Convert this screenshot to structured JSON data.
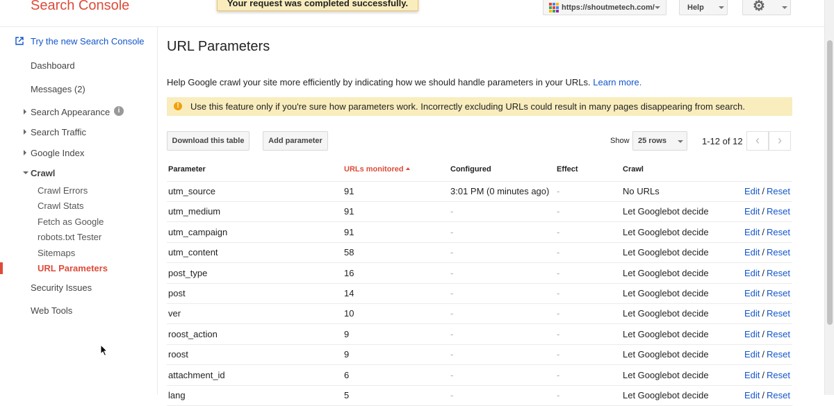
{
  "header": {
    "brand": "Search Console",
    "toast": "Your request was completed successfully.",
    "site": "https://shoutmetech.com/",
    "help_label": "Help",
    "settings_icon": "gear-icon"
  },
  "sidebar": {
    "new_console_link": "Try the new Search Console",
    "items": [
      {
        "label": "Dashboard"
      },
      {
        "label": "Messages (2)"
      },
      {
        "label": "Search Appearance"
      },
      {
        "label": "Search Traffic"
      },
      {
        "label": "Google Index"
      },
      {
        "label": "Crawl"
      },
      {
        "label": "Security Issues"
      },
      {
        "label": "Web Tools"
      }
    ],
    "crawl_children": [
      {
        "label": "Crawl Errors"
      },
      {
        "label": "Crawl Stats"
      },
      {
        "label": "Fetch as Google"
      },
      {
        "label": "robots.txt Tester"
      },
      {
        "label": "Sitemaps"
      },
      {
        "label": "URL Parameters"
      }
    ],
    "info_icon_glyph": "i",
    "active_color": "#dd4b39"
  },
  "main": {
    "title": "URL Parameters",
    "intro_text": "Help Google crawl your site more efficiently by indicating how we should handle parameters in your URLs.",
    "learn_more": "Learn more.",
    "warning": "Use this feature only if you're sure how parameters work. Incorrectly excluding URLs could result in many pages disappearing from search.",
    "warning_glyph": "!",
    "download_button": "Download this table",
    "add_parameter_button": "Add parameter",
    "show_label": "Show",
    "rows_option": "25 rows",
    "page_range": "1-12 of 12",
    "prev_glyph": "‹",
    "next_glyph": "›"
  },
  "table": {
    "headers": [
      "Parameter",
      "URLs monitored",
      "Configured",
      "Effect",
      "Crawl"
    ],
    "edit_label": "Edit",
    "separator": "/",
    "reset_label": "Reset",
    "rows": [
      {
        "parameter": "utm_source",
        "urls": "91",
        "configured": "3:01 PM (0 minutes ago)",
        "effect": "-",
        "crawl": "No URLs"
      },
      {
        "parameter": "utm_medium",
        "urls": "91",
        "configured": "-",
        "effect": "-",
        "crawl": "Let Googlebot decide"
      },
      {
        "parameter": "utm_campaign",
        "urls": "91",
        "configured": "-",
        "effect": "-",
        "crawl": "Let Googlebot decide"
      },
      {
        "parameter": "utm_content",
        "urls": "58",
        "configured": "-",
        "effect": "-",
        "crawl": "Let Googlebot decide"
      },
      {
        "parameter": "post_type",
        "urls": "16",
        "configured": "-",
        "effect": "-",
        "crawl": "Let Googlebot decide"
      },
      {
        "parameter": "post",
        "urls": "14",
        "configured": "-",
        "effect": "-",
        "crawl": "Let Googlebot decide"
      },
      {
        "parameter": "ver",
        "urls": "10",
        "configured": "-",
        "effect": "-",
        "crawl": "Let Googlebot decide"
      },
      {
        "parameter": "roost_action",
        "urls": "9",
        "configured": "-",
        "effect": "-",
        "crawl": "Let Googlebot decide"
      },
      {
        "parameter": "roost",
        "urls": "9",
        "configured": "-",
        "effect": "-",
        "crawl": "Let Googlebot decide"
      },
      {
        "parameter": "attachment_id",
        "urls": "6",
        "configured": "-",
        "effect": "-",
        "crawl": "Let Googlebot decide"
      },
      {
        "parameter": "lang",
        "urls": "5",
        "configured": "-",
        "effect": "-",
        "crawl": "Let Googlebot decide"
      }
    ]
  }
}
